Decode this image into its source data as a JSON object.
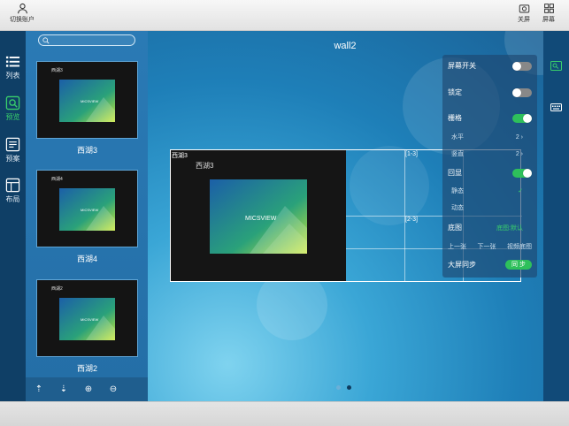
{
  "topbar": {
    "switch_user": "切换账户",
    "close": "关屏",
    "screen": "屏幕"
  },
  "nav": {
    "items": [
      {
        "label": "列表",
        "icon": "list-icon",
        "active": false
      },
      {
        "label": "预览",
        "icon": "preview-icon",
        "active": true
      },
      {
        "label": "预案",
        "icon": "plan-icon",
        "active": false
      },
      {
        "label": "布局",
        "icon": "layout-icon",
        "active": false
      }
    ]
  },
  "search": {
    "placeholder": ""
  },
  "thumbnails": [
    {
      "mini_label": "西湖3",
      "caption": "西湖3",
      "logo": "MICSVIEW"
    },
    {
      "mini_label": "西湖4",
      "caption": "西湖4",
      "logo": "MICSVIEW"
    },
    {
      "mini_label": "西湖2",
      "caption": "西湖2",
      "logo": "MICSVIEW"
    }
  ],
  "wall": {
    "title": "wall2",
    "window": {
      "tag": "西湖3",
      "name": "西湖3",
      "logo": "MICSVIEW"
    },
    "cells": [
      "[1-3]",
      "[2-3]"
    ]
  },
  "panel": {
    "screen_switch": "屏幕开关",
    "lock": "锁定",
    "grid": "栅格",
    "horizontal": "水平",
    "horizontal_value": "2",
    "vertical": "竖直",
    "vertical_value": "2",
    "echo": "回显",
    "static": "静态",
    "dynamic": "动态",
    "base_image": "底图",
    "base_image_value": "底图:默认",
    "prev": "上一张",
    "next": "下一张",
    "video_base": "视频底图",
    "sync_label": "大屏同步",
    "sync_button": "同 步",
    "states": {
      "screen_switch": false,
      "lock": false,
      "grid": true,
      "echo": true
    }
  },
  "pager": {
    "pages": 2,
    "current": 2
  },
  "colors": {
    "accent_green": "#2ec05b",
    "nav_bg": "#0f3f66",
    "panel_bg": "#1e466e"
  }
}
